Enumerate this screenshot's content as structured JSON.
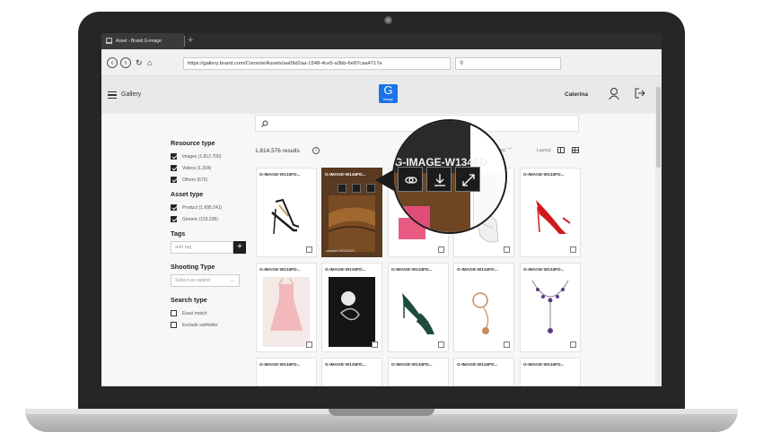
{
  "browser": {
    "tab_title": "Asset - Brand G-image",
    "new_tab": "+",
    "url": "https://gallery.brand.com/Console/Assets/aa09d2aa-1548-4ce5-a3bb-6e87caa4717e",
    "search_glyph": "⚲",
    "nav": {
      "back": "‹",
      "forward": "›",
      "reload": "↻",
      "home": "⌂"
    }
  },
  "header": {
    "menu_label": "Gallery",
    "logo_letter": "G",
    "logo_sub": "image",
    "user_name": "Caterina"
  },
  "sidebar": {
    "resource_type": {
      "title": "Resource type",
      "items": [
        {
          "label": "Images (1.812.700)",
          "checked": true
        },
        {
          "label": "Videos (1.204)",
          "checked": true
        },
        {
          "label": "Others (672)",
          "checked": true
        }
      ]
    },
    "asset_type": {
      "title": "Asset type",
      "items": [
        {
          "label": "Product (1.695.241)",
          "checked": true
        },
        {
          "label": "Generic (119.335)",
          "checked": true
        }
      ]
    },
    "tags": {
      "title": "Tags",
      "placeholder": "add tag",
      "add_glyph": "+"
    },
    "shooting_type": {
      "title": "Shooting Type",
      "placeholder": "Select an option"
    },
    "search_type": {
      "title": "Search type",
      "items": [
        {
          "label": "Exact match",
          "checked": false
        },
        {
          "label": "Exclude subfolder",
          "checked": false
        }
      ]
    }
  },
  "toolbar": {
    "results": "1.814.576 results",
    "info_glyph": "i",
    "sort": "date desc",
    "layout": "Layout"
  },
  "grid": {
    "card_title": "G-IMAGE-W134FD...",
    "hover_overlay_text": "uploaded 09/11/2022..."
  },
  "magnifier": {
    "title": "G-IMAGE-W134FD"
  },
  "colors": {
    "frame": "#262626",
    "accent": "#1a73e8",
    "dark_button": "#1e1e1e",
    "hover_card": "#5a3a20"
  }
}
